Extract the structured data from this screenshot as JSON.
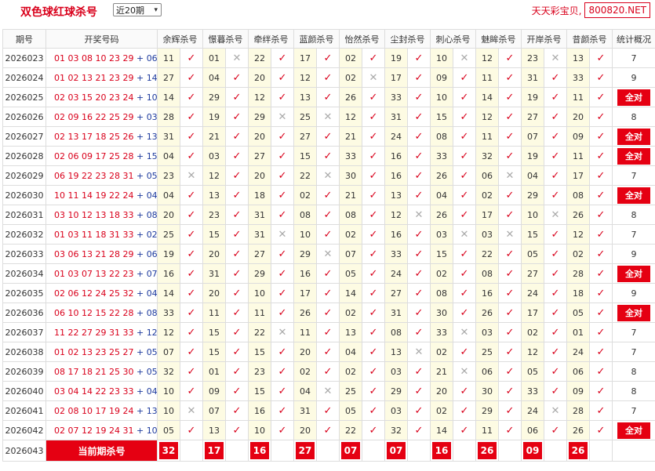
{
  "header": {
    "title": "双色球红球杀号",
    "select_value": "近20期",
    "brand_text": "天天彩宝贝,",
    "brand_site": "800820.NET"
  },
  "columns": {
    "period": "期号",
    "numbers": "开奖号码",
    "killers": [
      "余辉杀号",
      "憬暮杀号",
      "牵绊杀号",
      "蓝颜杀号",
      "怡然杀号",
      "尘封杀号",
      "刺心杀号",
      "魅眸杀号",
      "开岸杀号",
      "昔颜杀号"
    ],
    "stat": "统计概况"
  },
  "rows": [
    {
      "period": "2026023",
      "reds": "01 03 08 10 23 29",
      "blue": "06",
      "kills": [
        [
          "11",
          1
        ],
        [
          "01",
          0
        ],
        [
          "22",
          1
        ],
        [
          "17",
          1
        ],
        [
          "02",
          1
        ],
        [
          "19",
          1
        ],
        [
          "10",
          0
        ],
        [
          "12",
          1
        ],
        [
          "23",
          0
        ],
        [
          "13",
          1
        ]
      ],
      "stat": "7"
    },
    {
      "period": "2026024",
      "reds": "01 02 13 21 23 29",
      "blue": "14",
      "kills": [
        [
          "27",
          1
        ],
        [
          "04",
          1
        ],
        [
          "20",
          1
        ],
        [
          "12",
          1
        ],
        [
          "02",
          0
        ],
        [
          "17",
          1
        ],
        [
          "09",
          1
        ],
        [
          "11",
          1
        ],
        [
          "31",
          1
        ],
        [
          "33",
          1
        ]
      ],
      "stat": "9"
    },
    {
      "period": "2026025",
      "reds": "02 03 15 20 23 24",
      "blue": "10",
      "kills": [
        [
          "14",
          1
        ],
        [
          "29",
          1
        ],
        [
          "12",
          1
        ],
        [
          "13",
          1
        ],
        [
          "26",
          1
        ],
        [
          "33",
          1
        ],
        [
          "10",
          1
        ],
        [
          "14",
          1
        ],
        [
          "19",
          1
        ],
        [
          "11",
          1
        ]
      ],
      "stat": "全对"
    },
    {
      "period": "2026026",
      "reds": "02 09 16 22 25 29",
      "blue": "03",
      "kills": [
        [
          "28",
          1
        ],
        [
          "19",
          1
        ],
        [
          "29",
          0
        ],
        [
          "25",
          0
        ],
        [
          "12",
          1
        ],
        [
          "31",
          1
        ],
        [
          "15",
          1
        ],
        [
          "12",
          1
        ],
        [
          "27",
          1
        ],
        [
          "20",
          1
        ]
      ],
      "stat": "8"
    },
    {
      "period": "2026027",
      "reds": "02 13 17 18 25 26",
      "blue": "13",
      "kills": [
        [
          "31",
          1
        ],
        [
          "21",
          1
        ],
        [
          "20",
          1
        ],
        [
          "27",
          1
        ],
        [
          "21",
          1
        ],
        [
          "24",
          1
        ],
        [
          "08",
          1
        ],
        [
          "11",
          1
        ],
        [
          "07",
          1
        ],
        [
          "09",
          1
        ]
      ],
      "stat": "全对"
    },
    {
      "period": "2026028",
      "reds": "02 06 09 17 25 28",
      "blue": "15",
      "kills": [
        [
          "04",
          1
        ],
        [
          "03",
          1
        ],
        [
          "27",
          1
        ],
        [
          "15",
          1
        ],
        [
          "33",
          1
        ],
        [
          "16",
          1
        ],
        [
          "33",
          1
        ],
        [
          "32",
          1
        ],
        [
          "19",
          1
        ],
        [
          "11",
          1
        ]
      ],
      "stat": "全对"
    },
    {
      "period": "2026029",
      "reds": "06 19 22 23 28 31",
      "blue": "05",
      "kills": [
        [
          "23",
          0
        ],
        [
          "12",
          1
        ],
        [
          "20",
          1
        ],
        [
          "22",
          0
        ],
        [
          "30",
          1
        ],
        [
          "16",
          1
        ],
        [
          "26",
          1
        ],
        [
          "06",
          0
        ],
        [
          "04",
          1
        ],
        [
          "17",
          1
        ]
      ],
      "stat": "7"
    },
    {
      "period": "2026030",
      "reds": "10 11 14 19 22 24",
      "blue": "04",
      "kills": [
        [
          "04",
          1
        ],
        [
          "13",
          1
        ],
        [
          "18",
          1
        ],
        [
          "02",
          1
        ],
        [
          "21",
          1
        ],
        [
          "13",
          1
        ],
        [
          "04",
          1
        ],
        [
          "02",
          1
        ],
        [
          "29",
          1
        ],
        [
          "08",
          1
        ]
      ],
      "stat": "全对"
    },
    {
      "period": "2026031",
      "reds": "03 10 12 13 18 33",
      "blue": "08",
      "kills": [
        [
          "20",
          1
        ],
        [
          "23",
          1
        ],
        [
          "31",
          1
        ],
        [
          "08",
          1
        ],
        [
          "08",
          1
        ],
        [
          "12",
          0
        ],
        [
          "26",
          1
        ],
        [
          "17",
          1
        ],
        [
          "10",
          0
        ],
        [
          "26",
          1
        ]
      ],
      "stat": "8"
    },
    {
      "period": "2026032",
      "reds": "01 03 11 18 31 33",
      "blue": "02",
      "kills": [
        [
          "25",
          1
        ],
        [
          "15",
          1
        ],
        [
          "31",
          0
        ],
        [
          "10",
          1
        ],
        [
          "02",
          1
        ],
        [
          "16",
          1
        ],
        [
          "03",
          0
        ],
        [
          "03",
          0
        ],
        [
          "15",
          1
        ],
        [
          "12",
          1
        ]
      ],
      "stat": "7"
    },
    {
      "period": "2026033",
      "reds": "03 06 13 21 28 29",
      "blue": "06",
      "kills": [
        [
          "19",
          1
        ],
        [
          "20",
          1
        ],
        [
          "27",
          1
        ],
        [
          "29",
          0
        ],
        [
          "07",
          1
        ],
        [
          "33",
          1
        ],
        [
          "15",
          1
        ],
        [
          "22",
          1
        ],
        [
          "05",
          1
        ],
        [
          "02",
          1
        ]
      ],
      "stat": "9"
    },
    {
      "period": "2026034",
      "reds": "01 03 07 13 22 23",
      "blue": "07",
      "kills": [
        [
          "16",
          1
        ],
        [
          "31",
          1
        ],
        [
          "29",
          1
        ],
        [
          "16",
          1
        ],
        [
          "05",
          1
        ],
        [
          "24",
          1
        ],
        [
          "02",
          1
        ],
        [
          "08",
          1
        ],
        [
          "27",
          1
        ],
        [
          "28",
          1
        ]
      ],
      "stat": "全对"
    },
    {
      "period": "2026035",
      "reds": "02 06 12 24 25 32",
      "blue": "04",
      "kills": [
        [
          "14",
          1
        ],
        [
          "20",
          1
        ],
        [
          "10",
          1
        ],
        [
          "17",
          1
        ],
        [
          "14",
          1
        ],
        [
          "27",
          1
        ],
        [
          "08",
          1
        ],
        [
          "16",
          1
        ],
        [
          "24",
          1
        ],
        [
          "18",
          1
        ]
      ],
      "stat": "9"
    },
    {
      "period": "2026036",
      "reds": "06 10 12 15 22 28",
      "blue": "08",
      "kills": [
        [
          "33",
          1
        ],
        [
          "11",
          1
        ],
        [
          "11",
          1
        ],
        [
          "26",
          1
        ],
        [
          "02",
          1
        ],
        [
          "31",
          1
        ],
        [
          "30",
          1
        ],
        [
          "26",
          1
        ],
        [
          "17",
          1
        ],
        [
          "05",
          1
        ]
      ],
      "stat": "全对"
    },
    {
      "period": "2026037",
      "reds": "11 22 27 29 31 33",
      "blue": "12",
      "kills": [
        [
          "12",
          1
        ],
        [
          "15",
          1
        ],
        [
          "22",
          0
        ],
        [
          "11",
          1
        ],
        [
          "13",
          1
        ],
        [
          "08",
          1
        ],
        [
          "33",
          0
        ],
        [
          "03",
          1
        ],
        [
          "02",
          1
        ],
        [
          "01",
          1
        ]
      ],
      "stat": "7"
    },
    {
      "period": "2026038",
      "reds": "01 02 13 23 25 27",
      "blue": "05",
      "kills": [
        [
          "07",
          1
        ],
        [
          "15",
          1
        ],
        [
          "15",
          1
        ],
        [
          "20",
          1
        ],
        [
          "04",
          1
        ],
        [
          "13",
          0
        ],
        [
          "02",
          1
        ],
        [
          "25",
          1
        ],
        [
          "12",
          1
        ],
        [
          "24",
          1
        ]
      ],
      "stat": "7"
    },
    {
      "period": "2026039",
      "reds": "08 17 18 21 25 30",
      "blue": "05",
      "kills": [
        [
          "32",
          1
        ],
        [
          "01",
          1
        ],
        [
          "23",
          1
        ],
        [
          "02",
          1
        ],
        [
          "02",
          1
        ],
        [
          "03",
          1
        ],
        [
          "21",
          0
        ],
        [
          "06",
          1
        ],
        [
          "05",
          1
        ],
        [
          "06",
          1
        ]
      ],
      "stat": "8"
    },
    {
      "period": "2026040",
      "reds": "03 04 14 22 23 33",
      "blue": "04",
      "kills": [
        [
          "10",
          1
        ],
        [
          "09",
          1
        ],
        [
          "15",
          1
        ],
        [
          "04",
          0
        ],
        [
          "25",
          1
        ],
        [
          "29",
          1
        ],
        [
          "20",
          1
        ],
        [
          "30",
          1
        ],
        [
          "33",
          1
        ],
        [
          "09",
          1
        ]
      ],
      "stat": "8"
    },
    {
      "period": "2026041",
      "reds": "02 08 10 17 19 24",
      "blue": "13",
      "kills": [
        [
          "10",
          0
        ],
        [
          "07",
          1
        ],
        [
          "16",
          1
        ],
        [
          "31",
          1
        ],
        [
          "05",
          1
        ],
        [
          "03",
          1
        ],
        [
          "02",
          1
        ],
        [
          "29",
          1
        ],
        [
          "24",
          0
        ],
        [
          "28",
          1
        ]
      ],
      "stat": "7"
    },
    {
      "period": "2026042",
      "reds": "02 07 12 19 24 31",
      "blue": "10",
      "kills": [
        [
          "05",
          1
        ],
        [
          "13",
          1
        ],
        [
          "10",
          1
        ],
        [
          "20",
          1
        ],
        [
          "22",
          1
        ],
        [
          "32",
          1
        ],
        [
          "14",
          1
        ],
        [
          "11",
          1
        ],
        [
          "06",
          1
        ],
        [
          "26",
          1
        ]
      ],
      "stat": "全对"
    }
  ],
  "current": {
    "period": "2026043",
    "label": "当前期杀号",
    "nums": [
      "32",
      "17",
      "16",
      "27",
      "07",
      "07",
      "16",
      "26",
      "09",
      "26"
    ]
  },
  "marks": {
    "ok": "✓",
    "no": "✕"
  },
  "colors": {
    "accent": "#d9001b",
    "highlight": "#fdfbe3",
    "blue_ball": "#1f3c9e"
  }
}
